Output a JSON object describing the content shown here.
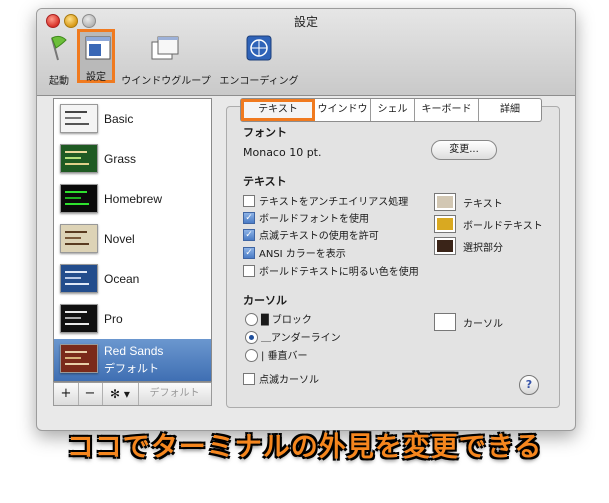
{
  "window": {
    "title": "設定"
  },
  "toolbar": [
    {
      "label": "起動",
      "icon": "flag-icon"
    },
    {
      "label": "設定",
      "icon": "settings-window-icon",
      "selected": true
    },
    {
      "label": "ウインドウグループ",
      "icon": "window-group-icon"
    },
    {
      "label": "エンコーディング",
      "icon": "globe-icon"
    }
  ],
  "profiles": [
    {
      "name": "Basic",
      "theme": "light"
    },
    {
      "name": "Grass",
      "theme": "green"
    },
    {
      "name": "Homebrew",
      "theme": "black-green"
    },
    {
      "name": "Novel",
      "theme": "beige"
    },
    {
      "name": "Ocean",
      "theme": "blue"
    },
    {
      "name": "Pro",
      "theme": "black"
    },
    {
      "name": "Red Sands",
      "sub": "デフォルト",
      "theme": "red",
      "selected": true
    }
  ],
  "left_buttons": {
    "add": "+",
    "remove": "−",
    "gear": "✻ ▾",
    "default": "デフォルト"
  },
  "tabs": [
    {
      "label": "テキスト",
      "selected": true
    },
    {
      "label": "ウインドウ"
    },
    {
      "label": "シェル"
    },
    {
      "label": "キーボード"
    },
    {
      "label": "詳細"
    }
  ],
  "font_section": {
    "heading": "フォント",
    "value": "Monaco 10 pt.",
    "change_button": "変更..."
  },
  "text_section": {
    "heading": "テキスト",
    "options": [
      {
        "label": "テキストをアンチエイリアス処理",
        "checked": false
      },
      {
        "label": "ボールドフォントを使用",
        "checked": true
      },
      {
        "label": "点滅テキストの使用を許可",
        "checked": true
      },
      {
        "label": "ANSI カラーを表示",
        "checked": true
      },
      {
        "label": "ボールドテキストに明るい色を使用",
        "checked": false
      }
    ],
    "colors": [
      {
        "label": "テキスト",
        "color": "#d2c7b3"
      },
      {
        "label": "ボールドテキスト",
        "color": "#d9a921"
      },
      {
        "label": "選択部分",
        "color": "#3a2418"
      }
    ]
  },
  "cursor_section": {
    "heading": "カーソル",
    "options": [
      {
        "glyph": "█",
        "label": "ブロック",
        "checked": false
      },
      {
        "glyph": "＿",
        "label": "アンダーライン",
        "checked": true
      },
      {
        "glyph": "|",
        "label": "垂直バー",
        "checked": false
      }
    ],
    "blink_label": "点滅カーソル",
    "blink_checked": false,
    "color_label": "カーソル",
    "cursor_color": "#ffffff"
  },
  "help": "?",
  "caption": "ココでターミナルの外見を変更できる",
  "accent_color": "#f07a1f"
}
